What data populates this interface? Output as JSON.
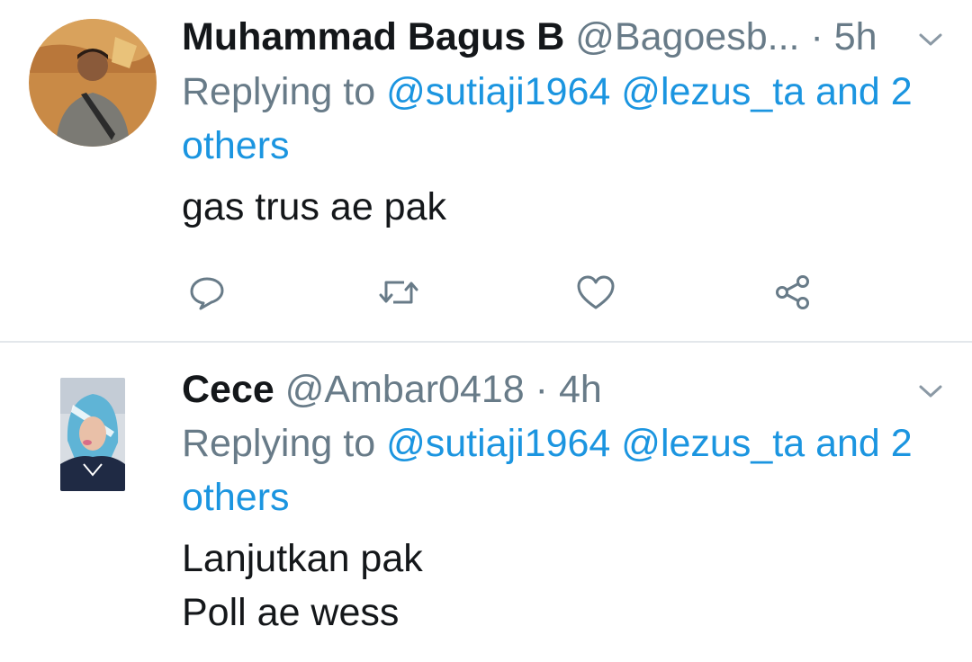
{
  "tweets": [
    {
      "name": "Muhammad Bagus B",
      "handle": "@Bagoesb...",
      "time": "· 5h",
      "replying_prefix": "Replying to",
      "mention1": "@sutiaji1964",
      "mention2": "@lezus_ta",
      "and_others": "and 2 others",
      "body_lines": [
        "gas trus ae pak"
      ],
      "actions": [
        "reply-icon",
        "retweet-icon",
        "like-icon",
        "share-icon"
      ]
    },
    {
      "name": "Cece",
      "handle": "@Ambar0418",
      "time": "· 4h",
      "replying_prefix": "Replying to",
      "mention1": "@sutiaji1964",
      "mention2": "@lezus_ta",
      "and_others": "and 2 others",
      "body_lines": [
        "Lanjutkan pak",
        "Poll ae wess"
      ]
    }
  ],
  "colors": {
    "name": "#14171a",
    "secondary": "#687b88",
    "link": "#1b95e0",
    "divider": "#e3e7eb"
  }
}
